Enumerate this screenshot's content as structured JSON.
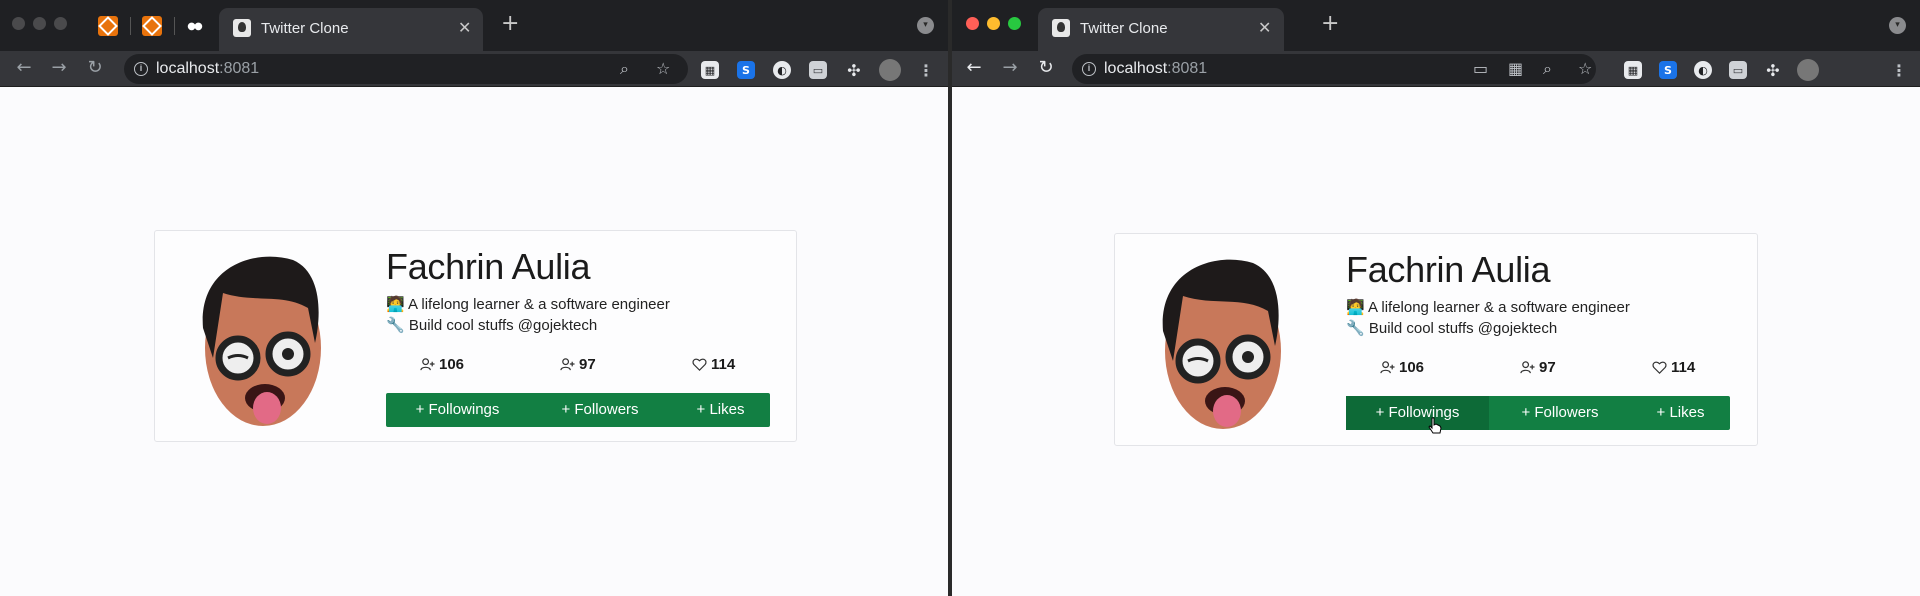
{
  "tab": {
    "title": "Twitter Clone",
    "close": "✕",
    "new_tab": "+",
    "menu": "▾"
  },
  "omnibox": {
    "host": "localhost",
    "port": ":8081"
  },
  "nav": {
    "back": "←",
    "forward": "→",
    "reload": "↻"
  },
  "profile": {
    "name": "Fachrin Aulia",
    "bio_line_1": "🧑‍💻 A lifelong learner & a software engineer",
    "bio_line_2": "🔧 Build cool stuffs @gojektech",
    "followings_count": "106",
    "followers_count": "97",
    "likes_count": "114",
    "buttons": {
      "followings": "+ Followings",
      "followers": "+ Followers",
      "likes": "+ Likes"
    }
  },
  "colors": {
    "button_green": "#127f43",
    "page_bg": "#fbfbfd",
    "chrome_dark": "#35363a"
  },
  "icons": [
    "person-add-icon",
    "heart-icon",
    "info-icon",
    "zoom-icon",
    "star-icon",
    "puzzle-icon"
  ]
}
